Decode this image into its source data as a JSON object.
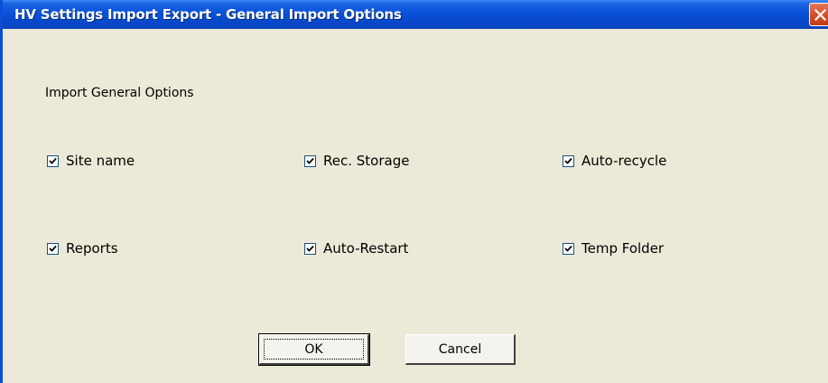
{
  "window": {
    "title": "HV Settings Import Export - General Import Options"
  },
  "group": {
    "label": "Import General Options"
  },
  "options": [
    {
      "label": "Site name",
      "checked": true
    },
    {
      "label": "Rec. Storage",
      "checked": true
    },
    {
      "label": "Auto-recycle",
      "checked": true
    },
    {
      "label": "Reports",
      "checked": true
    },
    {
      "label": "Auto-Restart",
      "checked": true
    },
    {
      "label": "Temp Folder",
      "checked": true
    }
  ],
  "buttons": {
    "ok_label": "OK",
    "cancel_label": "Cancel"
  },
  "icons": {
    "close": "close-icon",
    "check": "checkmark-icon"
  },
  "colors": {
    "titlebar": "#0a52d8",
    "dialog_bg": "#ece9d8",
    "close_button": "#d84f2b"
  }
}
